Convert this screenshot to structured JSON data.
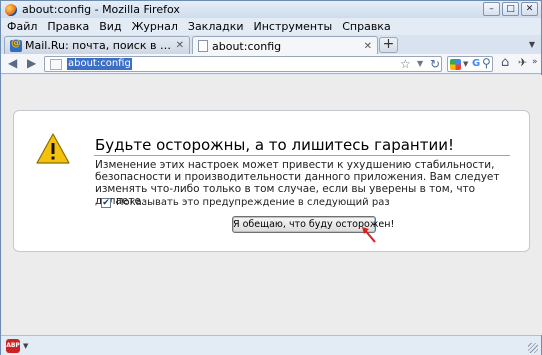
{
  "window": {
    "title": "about:config - Mozilla Firefox",
    "controls": {
      "minimize": "–",
      "maximize": "□",
      "close": "✕"
    }
  },
  "menubar": {
    "items": [
      {
        "label": "Файл"
      },
      {
        "label": "Правка"
      },
      {
        "label": "Вид"
      },
      {
        "label": "Журнал"
      },
      {
        "label": "Закладки"
      },
      {
        "label": "Инструменты"
      },
      {
        "label": "Справка"
      }
    ]
  },
  "tabs": {
    "items": [
      {
        "label": "Mail.Ru: почта, поиск в интернете, но...",
        "active": false,
        "icon": "mail-ru-icon"
      },
      {
        "label": "about:config",
        "active": true,
        "icon": "page-icon"
      }
    ],
    "close_glyph": "✕",
    "new_tab_glyph": "+",
    "tab_list_glyph": "▼"
  },
  "navbar": {
    "back_glyph": "◀",
    "forward_glyph": "▶",
    "url": "about:config",
    "bookmark_glyph": "☆",
    "dropdown_glyph": "▼",
    "reload_glyph": "↻",
    "search_engine_drop": "▼",
    "search_g": "G",
    "search_glyph": "⚲",
    "home_glyph": "⌂",
    "addon_glyph": "✈",
    "overflow_glyph": "»"
  },
  "warning": {
    "title": "Будьте осторожны, а то лишитесь гарантии!",
    "text": "Изменение этих настроек может привести к ухудшению стабильности, безопасности и производительности данного приложения. Вам следует изменять что-либо только в том случае, если вы уверены в том, что делаете.",
    "checkbox_checked": true,
    "checkbox_glyph": "✔",
    "checkbox_label": "Показывать это предупреждение в следующий раз",
    "button_label": "Я обещаю, что буду осторожен!"
  },
  "statusbar": {
    "abp_label": "ABP",
    "abp_drop": "▼"
  },
  "colors": {
    "url_highlight": "#3d6fc5",
    "warning_yellow": "#f4c20d",
    "cursor_red": "#d81e1e"
  }
}
